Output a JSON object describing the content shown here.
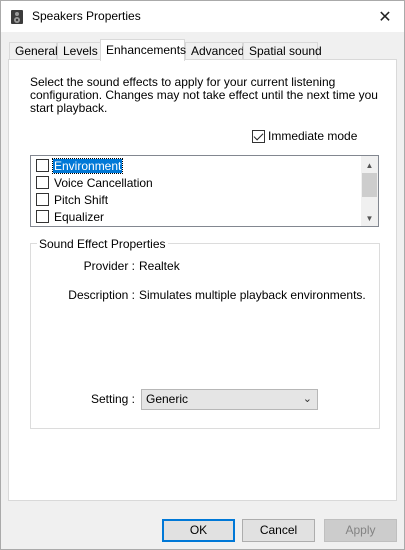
{
  "window": {
    "title": "Speakers Properties",
    "close_glyph": "✕"
  },
  "tabs": [
    {
      "label": "General"
    },
    {
      "label": "Levels"
    },
    {
      "label": "Enhancements"
    },
    {
      "label": "Advanced"
    },
    {
      "label": "Spatial sound"
    }
  ],
  "active_tab": "Enhancements",
  "enhancements": {
    "description": "Select the sound effects to apply for your current listening configuration. Changes may not take effect until the next time you start playback.",
    "immediate_mode": {
      "label": "Immediate mode",
      "checked": true
    },
    "effects": [
      {
        "label": "Environment",
        "checked": false,
        "selected": true
      },
      {
        "label": "Voice Cancellation",
        "checked": false,
        "selected": false
      },
      {
        "label": "Pitch Shift",
        "checked": false,
        "selected": false
      },
      {
        "label": "Equalizer",
        "checked": false,
        "selected": false
      }
    ],
    "properties": {
      "group_title": "Sound Effect Properties",
      "provider_label": "Provider :",
      "provider_value": "Realtek",
      "description_label": "Description :",
      "description_value": "Simulates multiple playback environments.",
      "setting_label": "Setting :",
      "setting_value": "Generic"
    }
  },
  "buttons": {
    "ok": "OK",
    "cancel": "Cancel",
    "apply": "Apply"
  },
  "icons": {
    "app": "speaker-icon",
    "close": "close-icon",
    "scroll_up": "chevron-up-icon",
    "scroll_down": "chevron-down-icon",
    "dropdown": "chevron-down-icon"
  },
  "colors": {
    "selection": "#0078d7",
    "panel": "#ffffff",
    "window": "#f0f0f0"
  }
}
